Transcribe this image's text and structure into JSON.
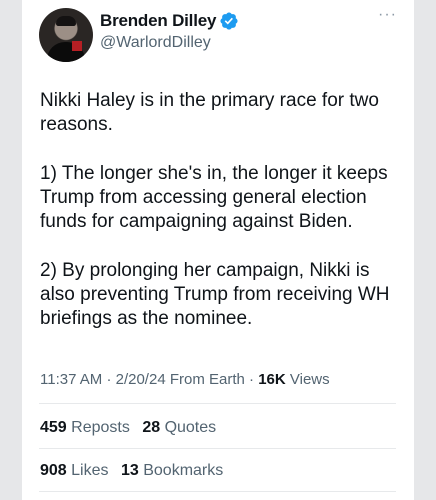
{
  "tweet": {
    "author_name": "Brenden Dilley",
    "handle": "@WarlordDilley",
    "more_label": "···",
    "paragraphs": [
      "Nikki Haley is in the primary race for two reasons.",
      "1) The longer she's in, the longer it keeps Trump from accessing general election funds for campaigning against Biden.",
      "2) By prolonging her campaign, Nikki is also preventing Trump from receiving WH briefings as the nominee."
    ],
    "time": "11:37 AM",
    "date": "2/20/24",
    "source": "From Earth",
    "views_count": "16K",
    "views_label": "Views",
    "reposts_count": "459",
    "reposts_label": "Reposts",
    "quotes_count": "28",
    "quotes_label": "Quotes",
    "likes_count": "908",
    "likes_label": "Likes",
    "bookmarks_count": "13",
    "bookmarks_label": "Bookmarks"
  },
  "icons": {
    "verified": "verified-badge-icon",
    "more": "more-options-icon"
  },
  "colors": {
    "verified_blue": "#1d9bf0",
    "text": "#0f1419",
    "secondary_text": "#536471",
    "page_background": "#e6e7e9"
  }
}
